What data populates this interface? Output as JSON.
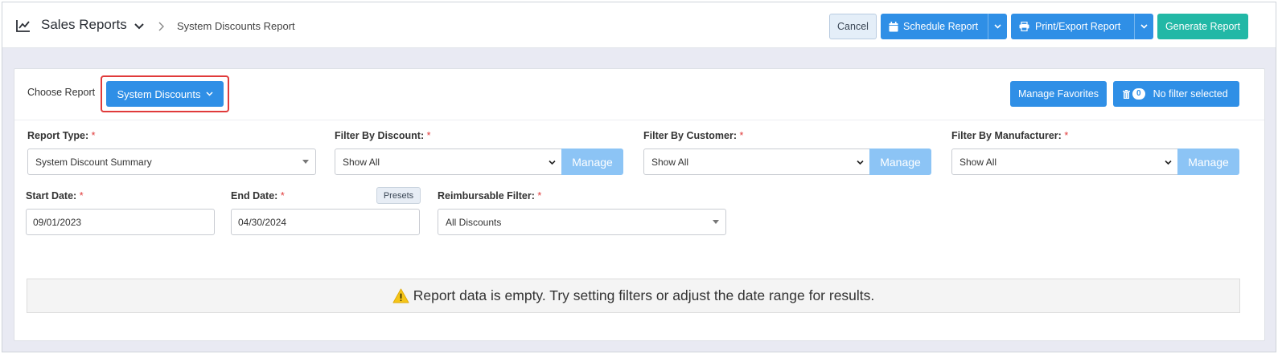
{
  "header": {
    "title": "Sales Reports",
    "breadcrumb": "System Discounts Report",
    "icon": "chart-line-icon",
    "buttons": {
      "cancel": "Cancel",
      "schedule": "Schedule Report",
      "print_export": "Print/Export Report",
      "generate": "Generate Report"
    }
  },
  "choose_report": {
    "label": "Choose Report",
    "selected": "System Discounts",
    "manage_favorites": "Manage Favorites",
    "filter_count": "0",
    "filter_text": "No filter selected"
  },
  "filters": {
    "report_type": {
      "label": "Report Type:",
      "value": "System Discount Summary"
    },
    "discount": {
      "label": "Filter By Discount:",
      "value": "Show All",
      "manage": "Manage"
    },
    "customer": {
      "label": "Filter By Customer:",
      "value": "Show All",
      "manage": "Manage"
    },
    "manufacturer": {
      "label": "Filter By Manufacturer:",
      "value": "Show All",
      "manage": "Manage"
    },
    "start_date": {
      "label": "Start Date:",
      "value": "09/01/2023"
    },
    "end_date": {
      "label": "End Date:",
      "value": "04/30/2024",
      "presets": "Presets"
    },
    "reimbursable": {
      "label": "Reimbursable Filter:",
      "value": "All Discounts"
    },
    "required_mark": "*"
  },
  "message": {
    "empty": "Report data is empty. Try setting filters or adjust the date range for results.",
    "icon": "warning-icon"
  },
  "colors": {
    "primary": "#2f8fe6",
    "teal": "#22b8a6",
    "manage": "#8cc4f5",
    "highlight": "#e03a3a",
    "warning": "#f5c518"
  }
}
